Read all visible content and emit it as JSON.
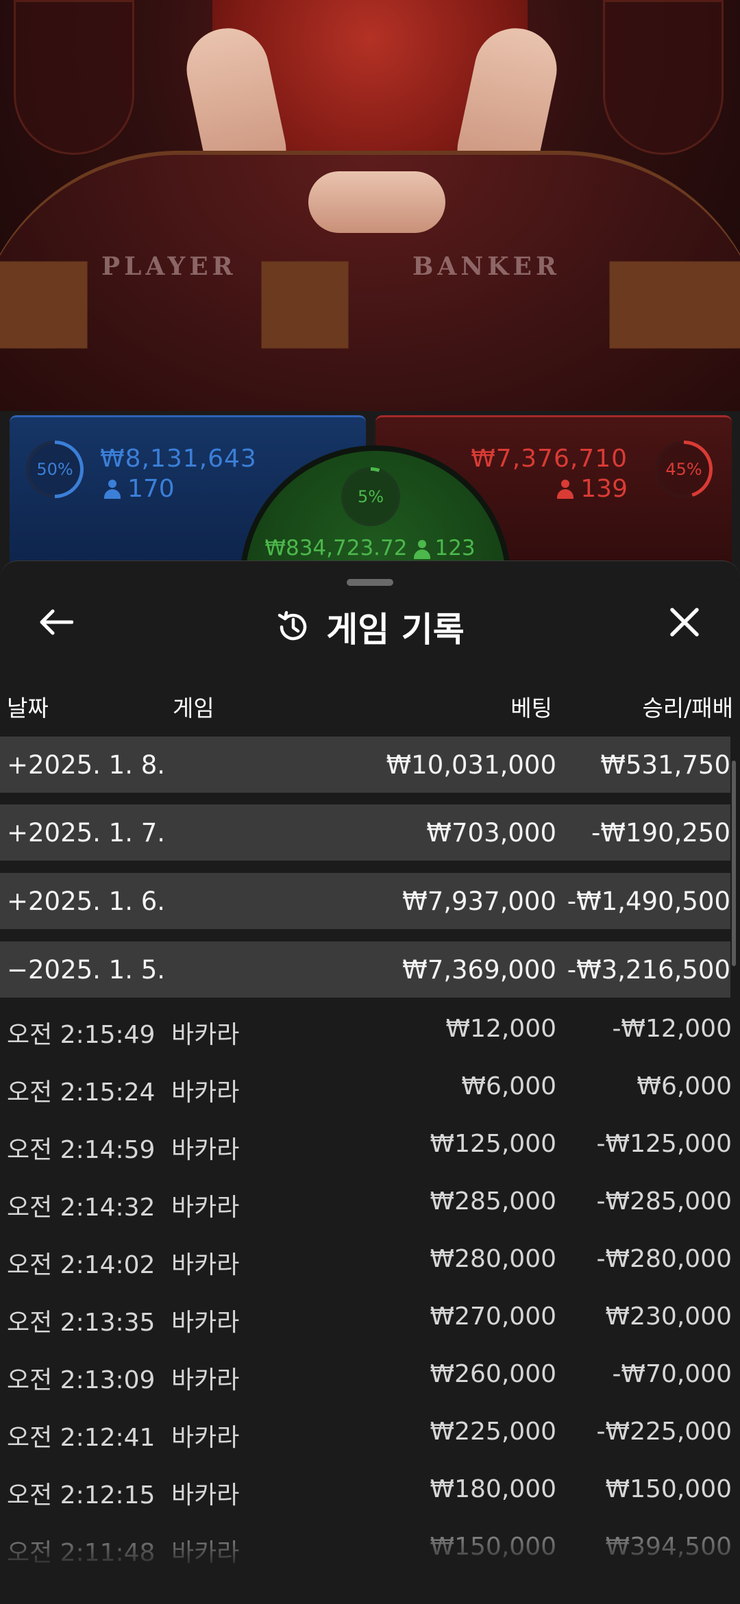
{
  "table": {
    "player_label": "PLAYER",
    "banker_label": "BANKER"
  },
  "bets": {
    "player": {
      "percent": "50%",
      "percent_value": 50,
      "amount": "₩8,131,643",
      "count": "170",
      "color": "#3b7fd8"
    },
    "banker": {
      "percent": "45%",
      "percent_value": 45,
      "amount": "₩7,376,710",
      "count": "139",
      "color": "#d93b35"
    },
    "tie": {
      "percent": "5%",
      "percent_value": 5,
      "amount": "₩834,723.72",
      "count": "123",
      "color": "#4cb84c"
    }
  },
  "history": {
    "title": "게임 기록",
    "icons": {
      "back": "arrow-left-icon",
      "history": "history-icon",
      "close": "close-icon"
    },
    "columns": {
      "date": "날짜",
      "game": "게임",
      "bet": "베팅",
      "result": "승리/패배"
    },
    "days": [
      {
        "date": "+2025. 1. 8.",
        "bet": "₩10,031,000",
        "result": "₩531,750"
      },
      {
        "date": "+2025. 1. 7.",
        "bet": "₩703,000",
        "result": "-₩190,250"
      },
      {
        "date": "+2025. 1. 6.",
        "bet": "₩7,937,000",
        "result": "-₩1,490,500"
      },
      {
        "date": "−2025. 1. 5.",
        "bet": "₩7,369,000",
        "result": "-₩3,216,500"
      }
    ],
    "games": [
      {
        "time": "오전 2:15:49",
        "game": "바카라",
        "bet": "₩12,000",
        "result": "-₩12,000"
      },
      {
        "time": "오전 2:15:24",
        "game": "바카라",
        "bet": "₩6,000",
        "result": "₩6,000"
      },
      {
        "time": "오전 2:14:59",
        "game": "바카라",
        "bet": "₩125,000",
        "result": "-₩125,000"
      },
      {
        "time": "오전 2:14:32",
        "game": "바카라",
        "bet": "₩285,000",
        "result": "-₩285,000"
      },
      {
        "time": "오전 2:14:02",
        "game": "바카라",
        "bet": "₩280,000",
        "result": "-₩280,000"
      },
      {
        "time": "오전 2:13:35",
        "game": "바카라",
        "bet": "₩270,000",
        "result": "₩230,000"
      },
      {
        "time": "오전 2:13:09",
        "game": "바카라",
        "bet": "₩260,000",
        "result": "-₩70,000"
      },
      {
        "time": "오전 2:12:41",
        "game": "바카라",
        "bet": "₩225,000",
        "result": "-₩225,000"
      },
      {
        "time": "오전 2:12:15",
        "game": "바카라",
        "bet": "₩180,000",
        "result": "₩150,000"
      },
      {
        "time": "오전 2:11:48",
        "game": "바카라",
        "bet": "₩150,000",
        "result": "₩394,500"
      }
    ]
  }
}
